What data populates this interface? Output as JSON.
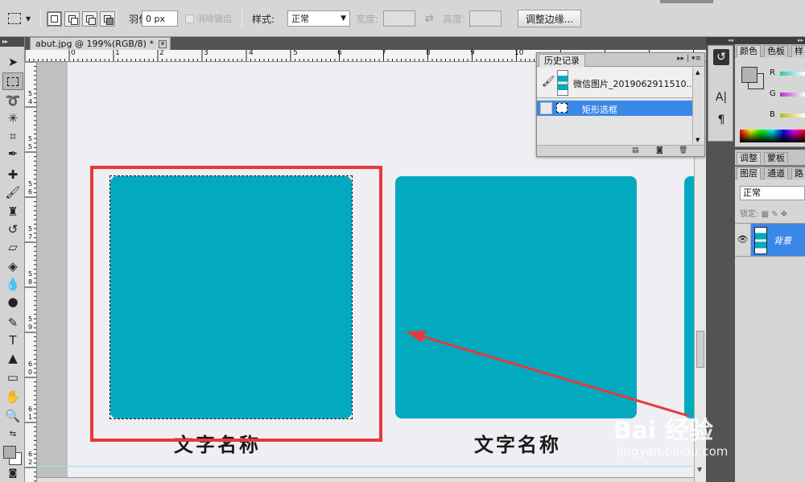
{
  "options_bar": {
    "feather_label": "羽化:",
    "feather_value": "0 px",
    "antialias_label": "消除锯齿",
    "style_label": "样式:",
    "style_value": "正常",
    "width_label": "宽度:",
    "height_label": "高度:",
    "refine_edge_button": "调整边缘..."
  },
  "document": {
    "tab_title": "abut.jpg @ 199%(RGB/8) *",
    "close_glyph": "✕",
    "ruler_h_numbers": [
      "0",
      "1",
      "2",
      "3",
      "4",
      "5",
      "6",
      "7",
      "8",
      "9",
      "10"
    ],
    "ruler_v_numbers": [
      "5",
      "4",
      "5",
      "5",
      "5",
      "6",
      "5",
      "7",
      "5",
      "8",
      "5",
      "9",
      "6",
      "0",
      "6",
      "1",
      "6",
      "2"
    ],
    "card_label_1": "文字名称",
    "card_label_2": "文字名称",
    "card_color": "#02a9bf",
    "annotation_color": "#e8393a"
  },
  "history_panel": {
    "tab_label": "历史记录",
    "menu_glyph": "▸▸ | ▾≡",
    "snapshot_label": "微信图片_2019062911510...",
    "step_label": "矩形选框"
  },
  "color_panel": {
    "tabs": [
      "颜色",
      "色板",
      "样"
    ],
    "channels": [
      "R",
      "G",
      "B"
    ]
  },
  "adjust_panel": {
    "tabs": [
      "调整",
      "蒙板"
    ]
  },
  "layers_panel": {
    "tabs": [
      "图层",
      "通道",
      "路"
    ],
    "blend_mode": "正常",
    "lock_label": "锁定:",
    "layer_name": "背景"
  },
  "watermark": {
    "brand": "Bai 经验",
    "url": "jingyan.baidu.com"
  }
}
